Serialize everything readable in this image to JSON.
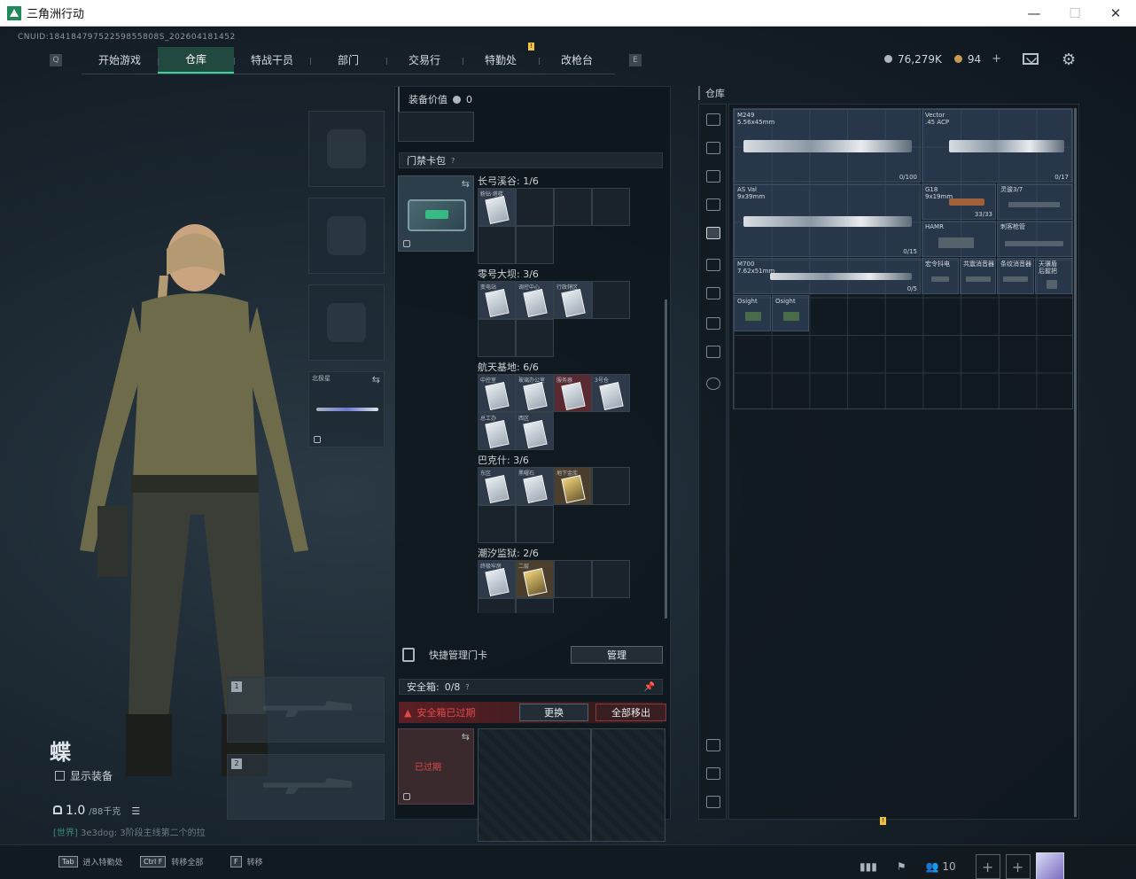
{
  "window": {
    "title": "三角洲行动",
    "minimize": "—",
    "maximize": "☐",
    "close": "✕"
  },
  "uid": "CNUID:18418479752259855808S_202604181452",
  "nav": {
    "left_key": "Q",
    "right_key": "E",
    "notify": "!",
    "tabs": [
      {
        "label": "开始游戏"
      },
      {
        "label": "仓库"
      },
      {
        "label": "特战干员"
      },
      {
        "label": "部门"
      },
      {
        "label": "交易行"
      },
      {
        "label": "特勤处"
      },
      {
        "label": "改枪台"
      }
    ]
  },
  "currency": {
    "coins": "76,279K",
    "bonds": "94",
    "plus": "+"
  },
  "character": {
    "name": "蝶",
    "show_equipment": "显示装备",
    "weight_value": "1.0",
    "weight_max": "/88千克",
    "world_chat_tag": "[世界]",
    "world_chat_text": "3e3dog: 3阶段主线第二个的拉"
  },
  "equipment": {
    "melee_label": "北极星",
    "weapon_slot_1": "1",
    "weapon_slot_2": "2"
  },
  "middle": {
    "equip_value_label": "装备价值",
    "equip_value": "0",
    "keycard_section": "门禁卡包",
    "help": "?",
    "regions": [
      {
        "title": "长弓溪谷: 1/6",
        "cards": [
          "粉钻·塔楼"
        ]
      },
      {
        "title": "零号大坝: 3/6",
        "cards": [
          "变电站",
          "调控中心",
          "行政辖区"
        ]
      },
      {
        "title": "航天基地: 6/6",
        "cards": [
          "中控室",
          "玻璃办公室",
          "服务器",
          "3号仓",
          "总工办",
          "西区"
        ]
      },
      {
        "title": "巴克什: 3/6",
        "cards": [
          "东区",
          "黑曜石",
          "地下金库"
        ]
      },
      {
        "title": "潮汐监狱: 2/6",
        "cards": [
          "终极牢房",
          "二层"
        ]
      }
    ],
    "quick_manage": "快捷管理门卡",
    "manage_button": "管理",
    "safe_label": "安全箱:",
    "safe_value": "0/8",
    "safe_expired": "安全箱已过期",
    "replace_button": "更换",
    "move_all_button": "全部移出",
    "box_expired": "已过期"
  },
  "warehouse": {
    "title": "仓库",
    "items": [
      {
        "name": "M249\n5.56x45mm",
        "count": "0/100"
      },
      {
        "name": "Vector\n.45 ACP",
        "count": "0/17"
      },
      {
        "name": "AS Val\n9x39mm",
        "count": "0/15"
      },
      {
        "name": "G18\n9x19mm",
        "count": "33/33"
      },
      {
        "name": "灵骏3/7",
        "count": ""
      },
      {
        "name": "HAMR",
        "count": ""
      },
      {
        "name": "刺客枪管",
        "count": ""
      },
      {
        "name": "M700\n7.62x51mm",
        "count": "0/5"
      },
      {
        "name": "宏令抖电",
        "count": ""
      },
      {
        "name": "共震消音器",
        "count": ""
      },
      {
        "name": "条纹消音器",
        "count": ""
      },
      {
        "name": "天骥盾\n后握把",
        "count": ""
      },
      {
        "name": "Osight",
        "count": ""
      },
      {
        "name": "Osight",
        "count": ""
      }
    ]
  },
  "bottom": {
    "hints": [
      {
        "key": "Tab",
        "label": "进入特勤处"
      },
      {
        "key": "Ctrl F",
        "label": "转移全部"
      },
      {
        "key": "F",
        "label": "转移"
      }
    ],
    "friends_count": "10",
    "notify": "!"
  }
}
